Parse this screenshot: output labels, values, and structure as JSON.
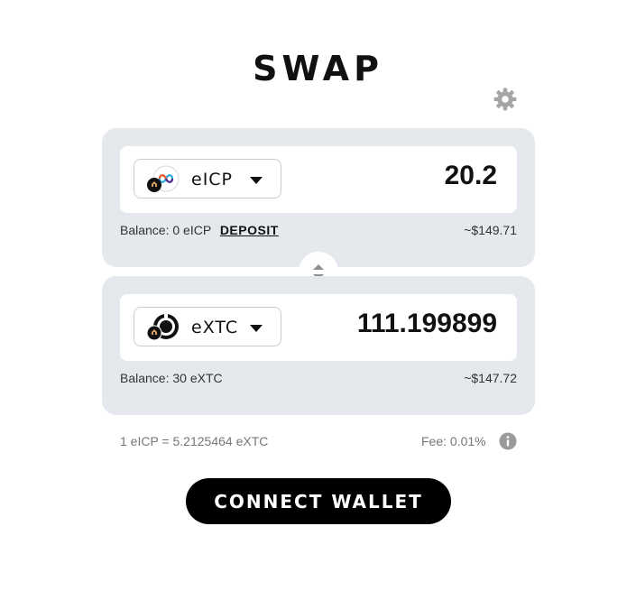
{
  "page": {
    "title": "SWAP"
  },
  "icons": {
    "settings": "gear-icon",
    "switch": "swap-arrows-icon",
    "info": "info-icon",
    "dropdown": "caret-down-icon"
  },
  "from": {
    "token": "eICP",
    "amount": "20.2",
    "balance_label": "Balance: 0 eICP",
    "deposit_label": "DEPOSIT",
    "usd_value": "~$149.71"
  },
  "to": {
    "token": "eXTC",
    "amount": "111.199899",
    "balance_label": "Balance: 30 eXTC",
    "usd_value": "~$147.72"
  },
  "footer": {
    "rate": "1 eICP = 5.2125464 eXTC",
    "fee": "Fee: 0.01%"
  },
  "connect_label": "CONNECT WALLET",
  "colors": {
    "panel": "#e5e8ed",
    "button": "#000000",
    "muted_text": "#777777"
  }
}
